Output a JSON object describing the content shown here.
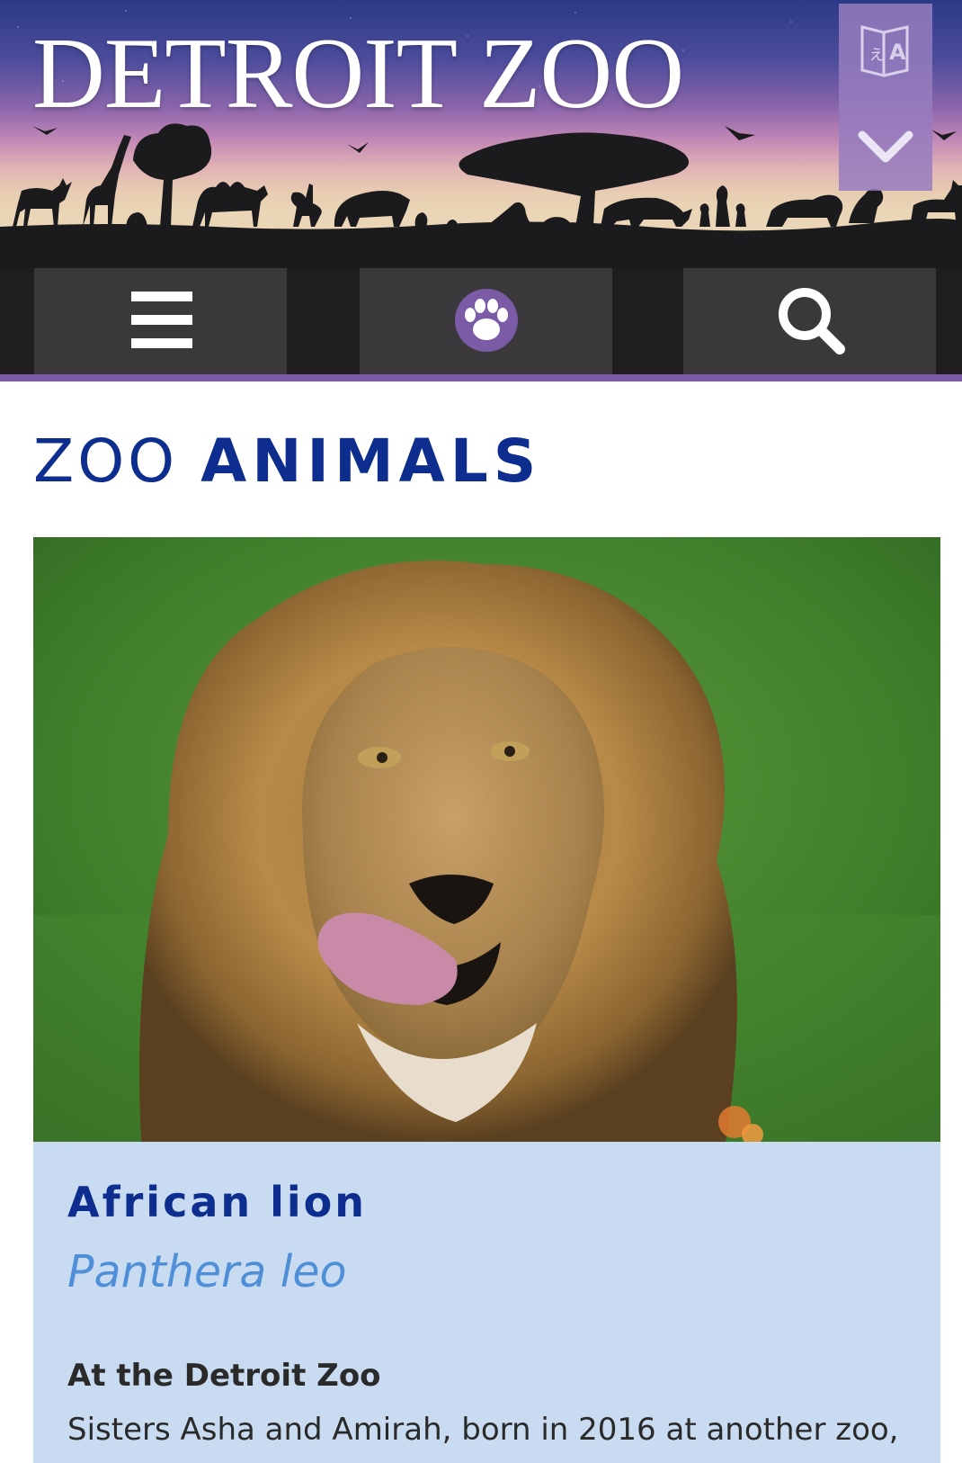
{
  "header": {
    "logo_text": "DETROIT ZOO",
    "translate_icon": "translate-icon",
    "expand_icon": "chevron-down-icon"
  },
  "nav": {
    "menu_icon": "hamburger-menu-icon",
    "paw_icon": "paw-icon",
    "search_icon": "search-icon"
  },
  "page": {
    "title_light": "ZOO",
    "title_bold": "ANIMALS"
  },
  "animal": {
    "photo_alt": "African lion",
    "name": "African lion",
    "latin_name": "Panthera leo",
    "section_heading": "At the Detroit Zoo",
    "section_text": "Sisters Asha and Amirah, born in 2016 at another zoo,"
  },
  "colors": {
    "brand_blue": "#0d2d8f",
    "latin_blue": "#4f8fd8",
    "accent_purple": "#7b5aa6",
    "card_background": "#c9dbf0",
    "nav_background": "#1f1d1f",
    "nav_button": "#3a383b"
  }
}
